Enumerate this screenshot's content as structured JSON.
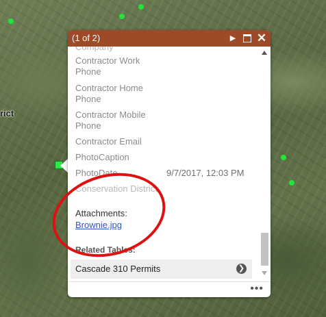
{
  "map": {
    "label": "rict"
  },
  "popup": {
    "title": "(1 of 2)",
    "fields": [
      {
        "label": "Company",
        "value": ""
      },
      {
        "label": "Contractor Work Phone",
        "value": ""
      },
      {
        "label": "Contractor Home Phone",
        "value": ""
      },
      {
        "label": "Contractor Mobile Phone",
        "value": ""
      },
      {
        "label": "Contractor Email",
        "value": ""
      },
      {
        "label": "PhotoCaption",
        "value": ""
      },
      {
        "label": "PhotoDate",
        "value": "9/7/2017, 12:03 PM"
      },
      {
        "label": "Conservation District",
        "value": ""
      }
    ],
    "attachments_label": "Attachments:",
    "attachment_link": "Brownie.jpg",
    "related_tables_label": "Related Tables:",
    "related_table": "Cascade 310 Permits",
    "more": "•••"
  },
  "colors": {
    "titlebar": "#9c4a27",
    "annotation": "#dd1111",
    "marker": "#27e23b",
    "link": "#2b58b8"
  },
  "icons": {
    "next": "triangle-right-icon",
    "maximize": "maximize-icon",
    "close": "close-icon",
    "chevron": "chevron-right-icon"
  }
}
